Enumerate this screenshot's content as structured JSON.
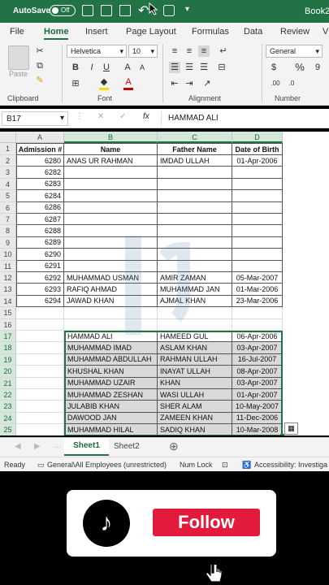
{
  "titlebar": {
    "autosave_label": "AutoSave",
    "toggle_state": "Off",
    "book_name": "Book2"
  },
  "tabs": [
    {
      "label": "File"
    },
    {
      "label": "Home"
    },
    {
      "label": "Insert"
    },
    {
      "label": "Page Layout"
    },
    {
      "label": "Formulas"
    },
    {
      "label": "Data"
    },
    {
      "label": "Review"
    },
    {
      "label": "V"
    }
  ],
  "ribbon": {
    "paste_label": "Paste",
    "clipboard_label": "Clipboard",
    "font_name": "Helvetica",
    "font_size": "10",
    "font_label": "Font",
    "alignment_label": "Alignment",
    "number_format": "General",
    "number_label": "Number",
    "bold": "B",
    "italic": "I",
    "underline": "U"
  },
  "formulabar": {
    "cell_ref": "B17",
    "content": "HAMMAD ALI",
    "fx": "fx"
  },
  "columns": [
    {
      "label": "A"
    },
    {
      "label": "B"
    },
    {
      "label": "C"
    },
    {
      "label": "D"
    }
  ],
  "headers": {
    "a": "Admission #",
    "b": "Name",
    "c": "Father Name",
    "d": "Date of Birth"
  },
  "rows": [
    {
      "num": "2",
      "a": "6280",
      "b": "ANAS UR RAHMAN",
      "c": "IMDAD ULLAH",
      "d": "01-Apr-2006"
    },
    {
      "num": "3",
      "a": "6282",
      "b": "",
      "c": "",
      "d": ""
    },
    {
      "num": "4",
      "a": "6283",
      "b": "",
      "c": "",
      "d": ""
    },
    {
      "num": "5",
      "a": "6284",
      "b": "",
      "c": "",
      "d": ""
    },
    {
      "num": "6",
      "a": "6286",
      "b": "",
      "c": "",
      "d": ""
    },
    {
      "num": "7",
      "a": "6287",
      "b": "",
      "c": "",
      "d": ""
    },
    {
      "num": "8",
      "a": "6288",
      "b": "",
      "c": "",
      "d": ""
    },
    {
      "num": "9",
      "a": "6289",
      "b": "",
      "c": "",
      "d": ""
    },
    {
      "num": "10",
      "a": "6290",
      "b": "",
      "c": "",
      "d": ""
    },
    {
      "num": "11",
      "a": "6291",
      "b": "",
      "c": "",
      "d": ""
    },
    {
      "num": "12",
      "a": "6292",
      "b": "MUHAMMAD USMAN",
      "c": "AMIR ZAMAN",
      "d": "05-Mar-2007"
    },
    {
      "num": "13",
      "a": "6293",
      "b": "RAFIQ AHMAD",
      "c": "MUHAMMAD JAN",
      "d": "01-Mar-2006"
    },
    {
      "num": "14",
      "a": "6294",
      "b": "JAWAD KHAN",
      "c": "AJMAL KHAN",
      "d": "23-Mar-2006"
    },
    {
      "num": "15",
      "a": "",
      "b": "",
      "c": "",
      "d": ""
    },
    {
      "num": "16",
      "a": "",
      "b": "",
      "c": "",
      "d": ""
    }
  ],
  "selected_rows": [
    {
      "num": "17",
      "b": "HAMMAD ALI",
      "c": "HAMEED GUL",
      "d": "06-Apr-2006"
    },
    {
      "num": "18",
      "b": "MUHAMMAD IMAD",
      "c": "ASLAM KHAN",
      "d": "03-Apr-2007"
    },
    {
      "num": "19",
      "b": "MUHAMMAD ABDULLAH",
      "c": "RAHMAN ULLAH",
      "d": "16-Jul-2007"
    },
    {
      "num": "20",
      "b": "KHUSHAL KHAN",
      "c": "INAYAT ULLAH",
      "d": "08-Apr-2007"
    },
    {
      "num": "21",
      "b": "MUHAMMAD UZAIR",
      "c": "KHAN",
      "d": "03-Apr-2007"
    },
    {
      "num": "22",
      "b": "MUHAMMAD ZESHAN",
      "c": "WASI ULLAH",
      "d": "01-Apr-2007"
    },
    {
      "num": "23",
      "b": "JULABIB KHAN",
      "c": "SHER ALAM",
      "d": "10-May-2007"
    },
    {
      "num": "24",
      "b": "DAWOOD JAN",
      "c": "ZAMEEN KHAN",
      "d": "11-Dec-2006"
    },
    {
      "num": "25",
      "b": "MUHAMMAD HILAL",
      "c": "SADIQ KHAN",
      "d": "10-Mar-2008"
    }
  ],
  "header_row_num": "1",
  "sheets": [
    {
      "label": "Sheet1"
    },
    {
      "label": "Sheet2"
    }
  ],
  "statusbar": {
    "ready": "Ready",
    "sensitivity": "General\\All Employees (unrestricted)",
    "numlock": "Num Lock",
    "accessibility": "Accessibility: Investiga"
  },
  "card": {
    "follow_label": "Follow",
    "logo_glyph": "♪"
  },
  "colors": {
    "excel_green": "#217346",
    "follow_red": "#e21b3c",
    "selection_fill": "#d9d9d9"
  }
}
